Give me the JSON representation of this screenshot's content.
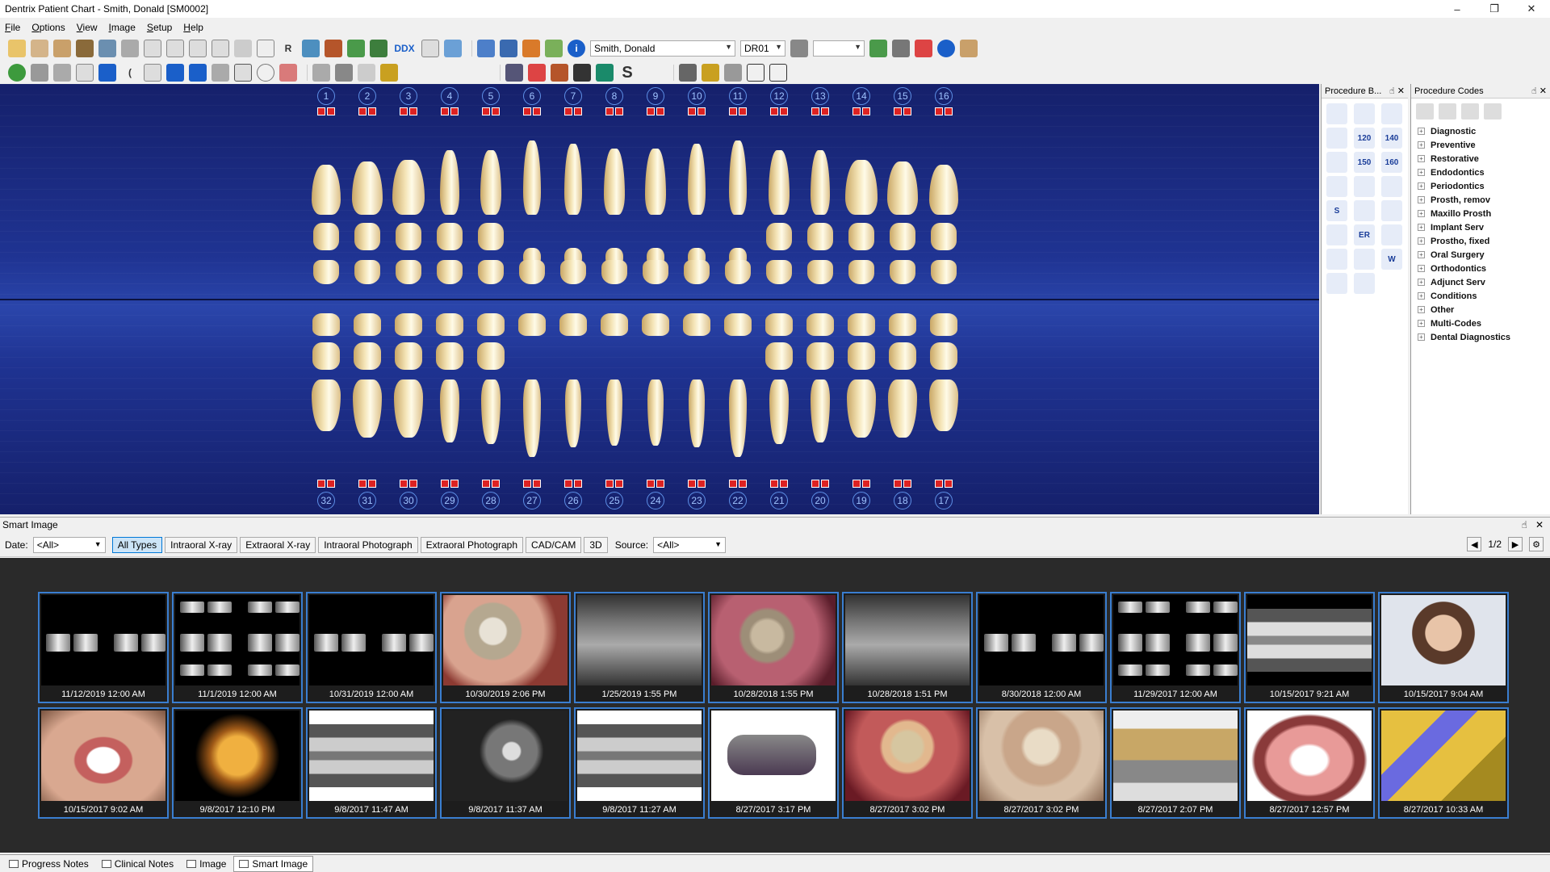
{
  "window": {
    "title": "Dentrix Patient Chart - Smith, Donald [SM0002]"
  },
  "menu": [
    "File",
    "Options",
    "View",
    "Image",
    "Setup",
    "Help"
  ],
  "toolbar": {
    "patient_name": "Smith, Donald",
    "provider": "DR01",
    "r_label": "R",
    "ddx_label": "DDX",
    "s_label": "S"
  },
  "teeth": {
    "upper": [
      "1",
      "2",
      "3",
      "4",
      "5",
      "6",
      "7",
      "8",
      "9",
      "10",
      "11",
      "12",
      "13",
      "14",
      "15",
      "16"
    ],
    "lower": [
      "32",
      "31",
      "30",
      "29",
      "28",
      "27",
      "26",
      "25",
      "24",
      "23",
      "22",
      "21",
      "20",
      "19",
      "18",
      "17"
    ]
  },
  "procedure_buttons": {
    "title": "Procedure B...",
    "labels": [
      "120",
      "140",
      "150",
      "160",
      "ER",
      "W",
      "S"
    ]
  },
  "procedure_codes": {
    "title": "Procedure Codes",
    "categories": [
      "Diagnostic",
      "Preventive",
      "Restorative",
      "Endodontics",
      "Periodontics",
      "Prosth, remov",
      "Maxillo Prosth",
      "Implant Serv",
      "Prostho, fixed",
      "Oral Surgery",
      "Orthodontics",
      "Adjunct Serv",
      "Conditions",
      "Other",
      "Multi-Codes",
      "Dental Diagnostics"
    ]
  },
  "smart_image": {
    "title": "Smart Image",
    "date_label": "Date:",
    "date_value": "<All>",
    "source_label": "Source:",
    "source_value": "<All>",
    "types": [
      "All Types",
      "Intraoral X-ray",
      "Extraoral X-ray",
      "Intraoral Photograph",
      "Extraoral Photograph",
      "CAD/CAM",
      "3D"
    ],
    "page": "1/2",
    "row1": [
      "11/12/2019 12:00 AM",
      "11/1/2019 12:00 AM",
      "10/31/2019 12:00 AM",
      "10/30/2019 2:06 PM",
      "1/25/2019 1:55 PM",
      "10/28/2018 1:55 PM",
      "10/28/2018 1:51 PM",
      "8/30/2018 12:00 AM",
      "11/29/2017 12:00 AM",
      "10/15/2017 9:21 AM",
      "10/15/2017 9:04 AM"
    ],
    "row2": [
      "10/15/2017 9:02 AM",
      "9/8/2017 12:10 PM",
      "9/8/2017 11:47 AM",
      "9/8/2017 11:37 AM",
      "9/8/2017 11:27 AM",
      "8/27/2017 3:17 PM",
      "8/27/2017 3:02 PM",
      "8/27/2017 3:02 PM",
      "8/27/2017 2:07 PM",
      "8/27/2017 12:57 PM",
      "8/27/2017 10:33 AM"
    ]
  },
  "bottom_tabs": [
    "Progress Notes",
    "Clinical Notes",
    "Image",
    "Smart Image"
  ]
}
